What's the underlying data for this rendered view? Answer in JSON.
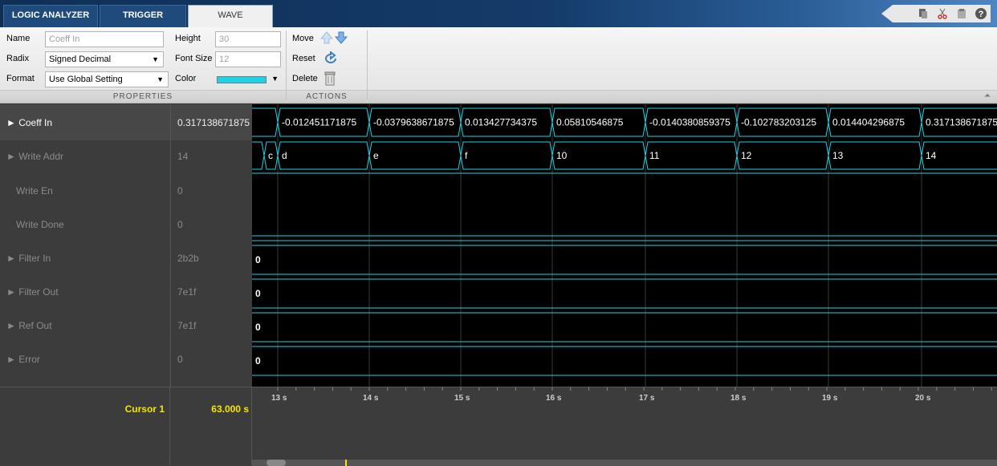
{
  "tabs": [
    {
      "label": "LOGIC ANALYZER"
    },
    {
      "label": "TRIGGER"
    },
    {
      "label": "WAVE"
    }
  ],
  "quick_access": [
    "dock-icon",
    "cut-icon",
    "paste-icon",
    "help-icon"
  ],
  "properties": {
    "name_label": "Name",
    "name_value": "Coeff In",
    "radix_label": "Radix",
    "radix_value": "Signed Decimal",
    "format_label": "Format",
    "format_value": "Use Global Setting",
    "height_label": "Height",
    "height_value": "30",
    "fontsize_label": "Font Size",
    "fontsize_value": "12",
    "color_label": "Color",
    "color_value": "#19d3e6",
    "section_label": "PROPERTIES"
  },
  "actions": {
    "move_label": "Move",
    "reset_label": "Reset",
    "delete_label": "Delete",
    "section_label": "ACTIONS"
  },
  "signals": [
    {
      "name": "Coeff In",
      "value": "0.317138671875",
      "expandable": true,
      "active": true
    },
    {
      "name": "Write Addr",
      "value": "14",
      "expandable": true,
      "active": false
    },
    {
      "name": "Write En",
      "value": "0",
      "expandable": false,
      "active": false
    },
    {
      "name": "Write Done",
      "value": "0",
      "expandable": false,
      "active": false
    },
    {
      "name": "Filter In",
      "value": "2b2b",
      "expandable": true,
      "active": false
    },
    {
      "name": "Filter Out",
      "value": "7e1f",
      "expandable": true,
      "active": false
    },
    {
      "name": "Ref Out",
      "value": "7e1f",
      "expandable": true,
      "active": false
    },
    {
      "name": "Error",
      "value": "0",
      "expandable": true,
      "active": false
    }
  ],
  "waves": {
    "coeff_in": [
      "-0.012451171875",
      "-0.0379638671875",
      "0.013427734375",
      "0.05810546875",
      "-0.0140380859375",
      "-0.102783203125",
      "0.014404296875",
      "0.317138671875"
    ],
    "write_addr": [
      "c",
      "d",
      "e",
      "f",
      "10",
      "11",
      "12",
      "13",
      "14"
    ],
    "filter_in": "0",
    "filter_out": "0",
    "ref_out": "0",
    "error": "0"
  },
  "time_axis": [
    "13 s",
    "14 s",
    "15 s",
    "16 s",
    "17 s",
    "18 s",
    "19 s",
    "20 s"
  ],
  "cursor": {
    "name": "Cursor 1",
    "value": "63.000 s"
  },
  "wave_color": "#19d3e6",
  "cursor_color": "#f5e600"
}
